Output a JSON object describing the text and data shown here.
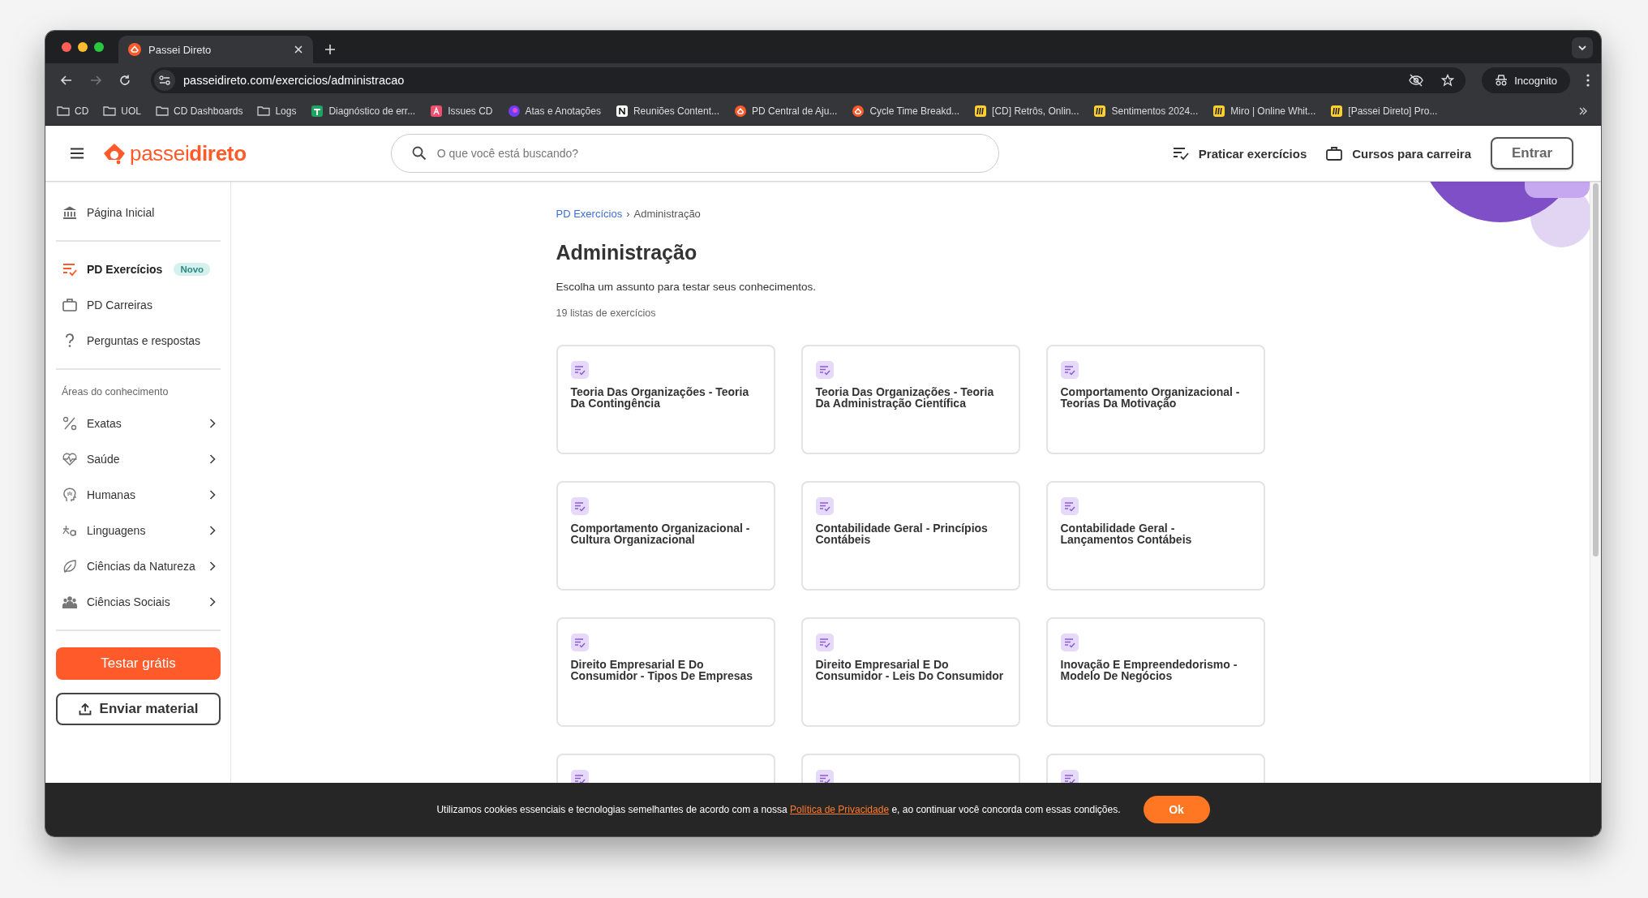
{
  "browser": {
    "tab": {
      "title": "Passei Direto",
      "selected": true
    },
    "url": "passeidireto.com/exercicios/administracao",
    "profile": "Incognito",
    "bookmarks": [
      {
        "label": "CD"
      },
      {
        "label": "UOL"
      },
      {
        "label": "CD Dashboards"
      },
      {
        "label": "Logs"
      },
      {
        "label": "Diagnóstico de err..."
      },
      {
        "label": "Issues CD"
      },
      {
        "label": "Atas e Anotações"
      },
      {
        "label": "Reuniões Content..."
      },
      {
        "label": "PD Central de Aju..."
      },
      {
        "label": "Cycle Time Breakd..."
      },
      {
        "label": "[CD] Retrôs, Onlin..."
      },
      {
        "label": "Sentimentos 2024..."
      },
      {
        "label": "Miro | Online Whit..."
      },
      {
        "label": "[Passei Direto] Pro..."
      }
    ]
  },
  "header": {
    "logo": "passei**direto**",
    "search": {
      "placeholder": "O que você está buscando?"
    },
    "nav": [
      "Praticar exercícios",
      "Cursos para carreira"
    ],
    "login": "Entrar"
  },
  "sidebar": {
    "items": [
      {
        "label": "Página Inicial",
        "selected": false
      },
      {
        "label": "PD Exercícios",
        "selected": true,
        "badge": "Novo"
      },
      {
        "label": "PD Carreiras",
        "selected": false
      },
      {
        "label": "Perguntas e respostas",
        "selected": false
      }
    ],
    "areas_title": "Áreas do conhecimento",
    "areas": [
      "Exatas",
      "Saúde",
      "Humanas",
      "Linguagens",
      "Ciências da Natureza",
      "Ciências Sociais"
    ],
    "primary_button": "Testar grátis",
    "upload_button": "Enviar material"
  },
  "main": {
    "breadcrumb": {
      "link": "PD Exercícios",
      "separator": "›",
      "current": "Administração"
    },
    "title": "Administração",
    "subtitle": "Escolha um assunto para testar seus conhecimentos.",
    "count": "19 listas de exercícios",
    "cards": [
      {
        "title": "Teoria Das Organizações - Teoria Da Contingência"
      },
      {
        "title": "Teoria Das Organizações - Teoria Da Administração Científica"
      },
      {
        "title": "Comportamento Organizacional - Teorias Da Motivação"
      },
      {
        "title": "Comportamento Organizacional - Cultura Organizacional"
      },
      {
        "title": "Contabilidade Geral - Princípios Contábeis"
      },
      {
        "title": "Contabilidade Geral - Lançamentos Contábeis"
      },
      {
        "title": "Direito Empresarial E Do Consumidor - Tipos De Empresas"
      },
      {
        "title": "Direito Empresarial E Do Consumidor - Leis Do Consumidor"
      },
      {
        "title": "Inovação E Empreendedorismo - Modelo De Negócios"
      },
      {
        "kind": "covered"
      },
      {
        "kind": "covered"
      },
      {
        "kind": "covered"
      }
    ]
  },
  "cookie_bar": {
    "text_before": "Utilizamos cookies essenciais e tecnologias semelhantes de acordo com a nossa ",
    "link": "Política de Privacidade",
    "text_after": " e, ao continuar você concorda com essas condições.",
    "button": "Ok"
  }
}
